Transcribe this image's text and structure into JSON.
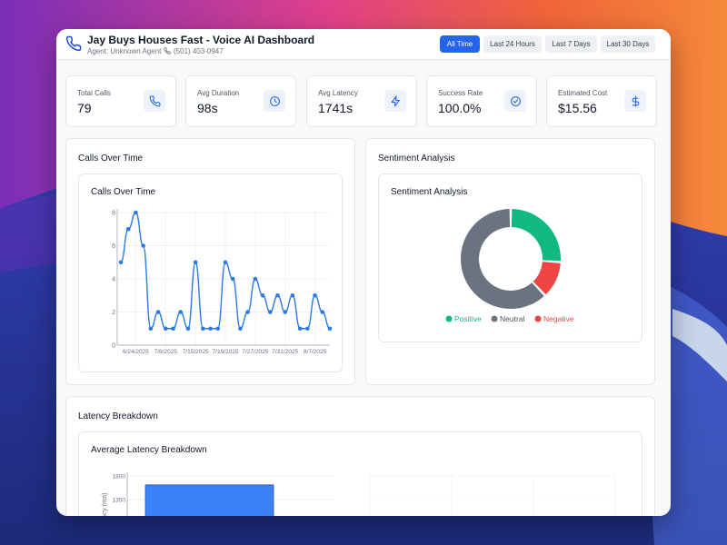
{
  "header": {
    "title": "Jay Buys Houses Fast - Voice AI Dashboard",
    "agent": "Agent: Unknown Agent",
    "phone": "(501) 403-0947",
    "filters": [
      {
        "label": "All Time",
        "active": true
      },
      {
        "label": "Last 24 Hours",
        "active": false
      },
      {
        "label": "Last 7 Days",
        "active": false
      },
      {
        "label": "Last 30 Days",
        "active": false
      }
    ]
  },
  "stats": [
    {
      "label": "Total Calls",
      "value": "79",
      "icon": "phone-icon"
    },
    {
      "label": "Avg Duration",
      "value": "98s",
      "icon": "clock-icon"
    },
    {
      "label": "Avg Latency",
      "value": "1741s",
      "icon": "lightning-icon"
    },
    {
      "label": "Success Rate",
      "value": "100.0%",
      "icon": "check-circle-icon"
    },
    {
      "label": "Estimated Cost",
      "value": "$15.56",
      "icon": "dollar-icon"
    }
  ],
  "sections": {
    "calls_over_time": "Calls Over Time",
    "sentiment": "Sentiment Analysis",
    "latency": "Latency Breakdown"
  },
  "colors": {
    "accent": "#2563eb",
    "line": "#2b7be5",
    "positive": "#10b981",
    "neutral": "#6b7280",
    "negative": "#ef4444",
    "bar": "#3b82f6"
  },
  "chart_data": [
    {
      "type": "line",
      "title": "Calls Over Time",
      "xticks": [
        "6/24/2025",
        "7/8/2025",
        "7/15/2025",
        "7/19/2025",
        "7/27/2025",
        "7/31/2025",
        "8/7/2025"
      ],
      "y": [
        5,
        7,
        8,
        6,
        1,
        2,
        1,
        1,
        2,
        1,
        5,
        1,
        1,
        1,
        5,
        4,
        1,
        2,
        4,
        3,
        2,
        3,
        2,
        3,
        1,
        1,
        3,
        2,
        1
      ],
      "ylim": [
        0,
        8
      ],
      "yticks": [
        0,
        2,
        4,
        6,
        8
      ],
      "grid": true
    },
    {
      "type": "pie",
      "title": "Sentiment Analysis",
      "labels": [
        "Positive",
        "Neutral",
        "Negative"
      ],
      "values": [
        26,
        62,
        12
      ],
      "legend": "bottom"
    },
    {
      "type": "bar",
      "title": "Average Latency Breakdown",
      "ylabel": "Latency (ms)",
      "yticks": [
        1350,
        1800
      ],
      "values": [
        1630
      ]
    }
  ]
}
